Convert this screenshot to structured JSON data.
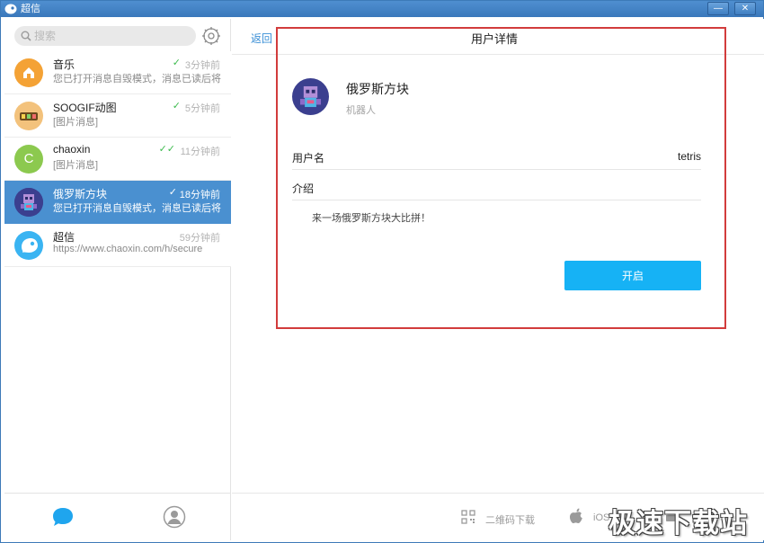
{
  "window": {
    "title": "超信",
    "minimize_glyph": "—",
    "close_glyph": "✕",
    "accent": "#4a90d0"
  },
  "search": {
    "placeholder": "搜索",
    "icon": "search-icon"
  },
  "chats": [
    {
      "name": "音乐",
      "preview": "您已打开消息自毁模式，消息已读后将...",
      "time": "3分钟前",
      "status": "✓",
      "avatar_color": "#f4a235",
      "avatar_icon": "home-icon"
    },
    {
      "name": "SOOGIF动图",
      "preview": "[图片消息]",
      "time": "5分钟前",
      "status": "✓",
      "avatar_color": "#f3c27c",
      "avatar_icon": "gif-logo"
    },
    {
      "name": "chaoxin",
      "preview": "[图片消息]",
      "time": "11分钟前",
      "status": "✓✓",
      "avatar_color": "#8cc94f",
      "avatar_letter": "C"
    },
    {
      "name": "俄罗斯方块",
      "preview": "您已打开消息自毁模式，消息已读后将...",
      "time": "18分钟前",
      "status": "✓",
      "active": true,
      "avatar_icon": "pixel-robot-avatar"
    },
    {
      "name": "超信",
      "preview": "https://www.chaoxin.com/h/secure",
      "time": "59分钟前",
      "status": "",
      "avatar_color": "#3ab4f2",
      "avatar_icon": "chaoxin-logo"
    }
  ],
  "header": {
    "back_label": "返回",
    "title": "用户详情"
  },
  "profile": {
    "name": "俄罗斯方块",
    "role": "机器人",
    "fields": [
      {
        "label": "用户名",
        "value": "tetris"
      },
      {
        "label": "介绍",
        "value": ""
      }
    ],
    "intro": "来一场俄罗斯方块大比拼！",
    "action_label": "开启",
    "action_color": "#16b2f5",
    "highlight_color": "#d23c3c"
  },
  "footer": {
    "qr_label": "二维码下载",
    "ios_label": "iOS"
  },
  "watermark": "极速下载站"
}
